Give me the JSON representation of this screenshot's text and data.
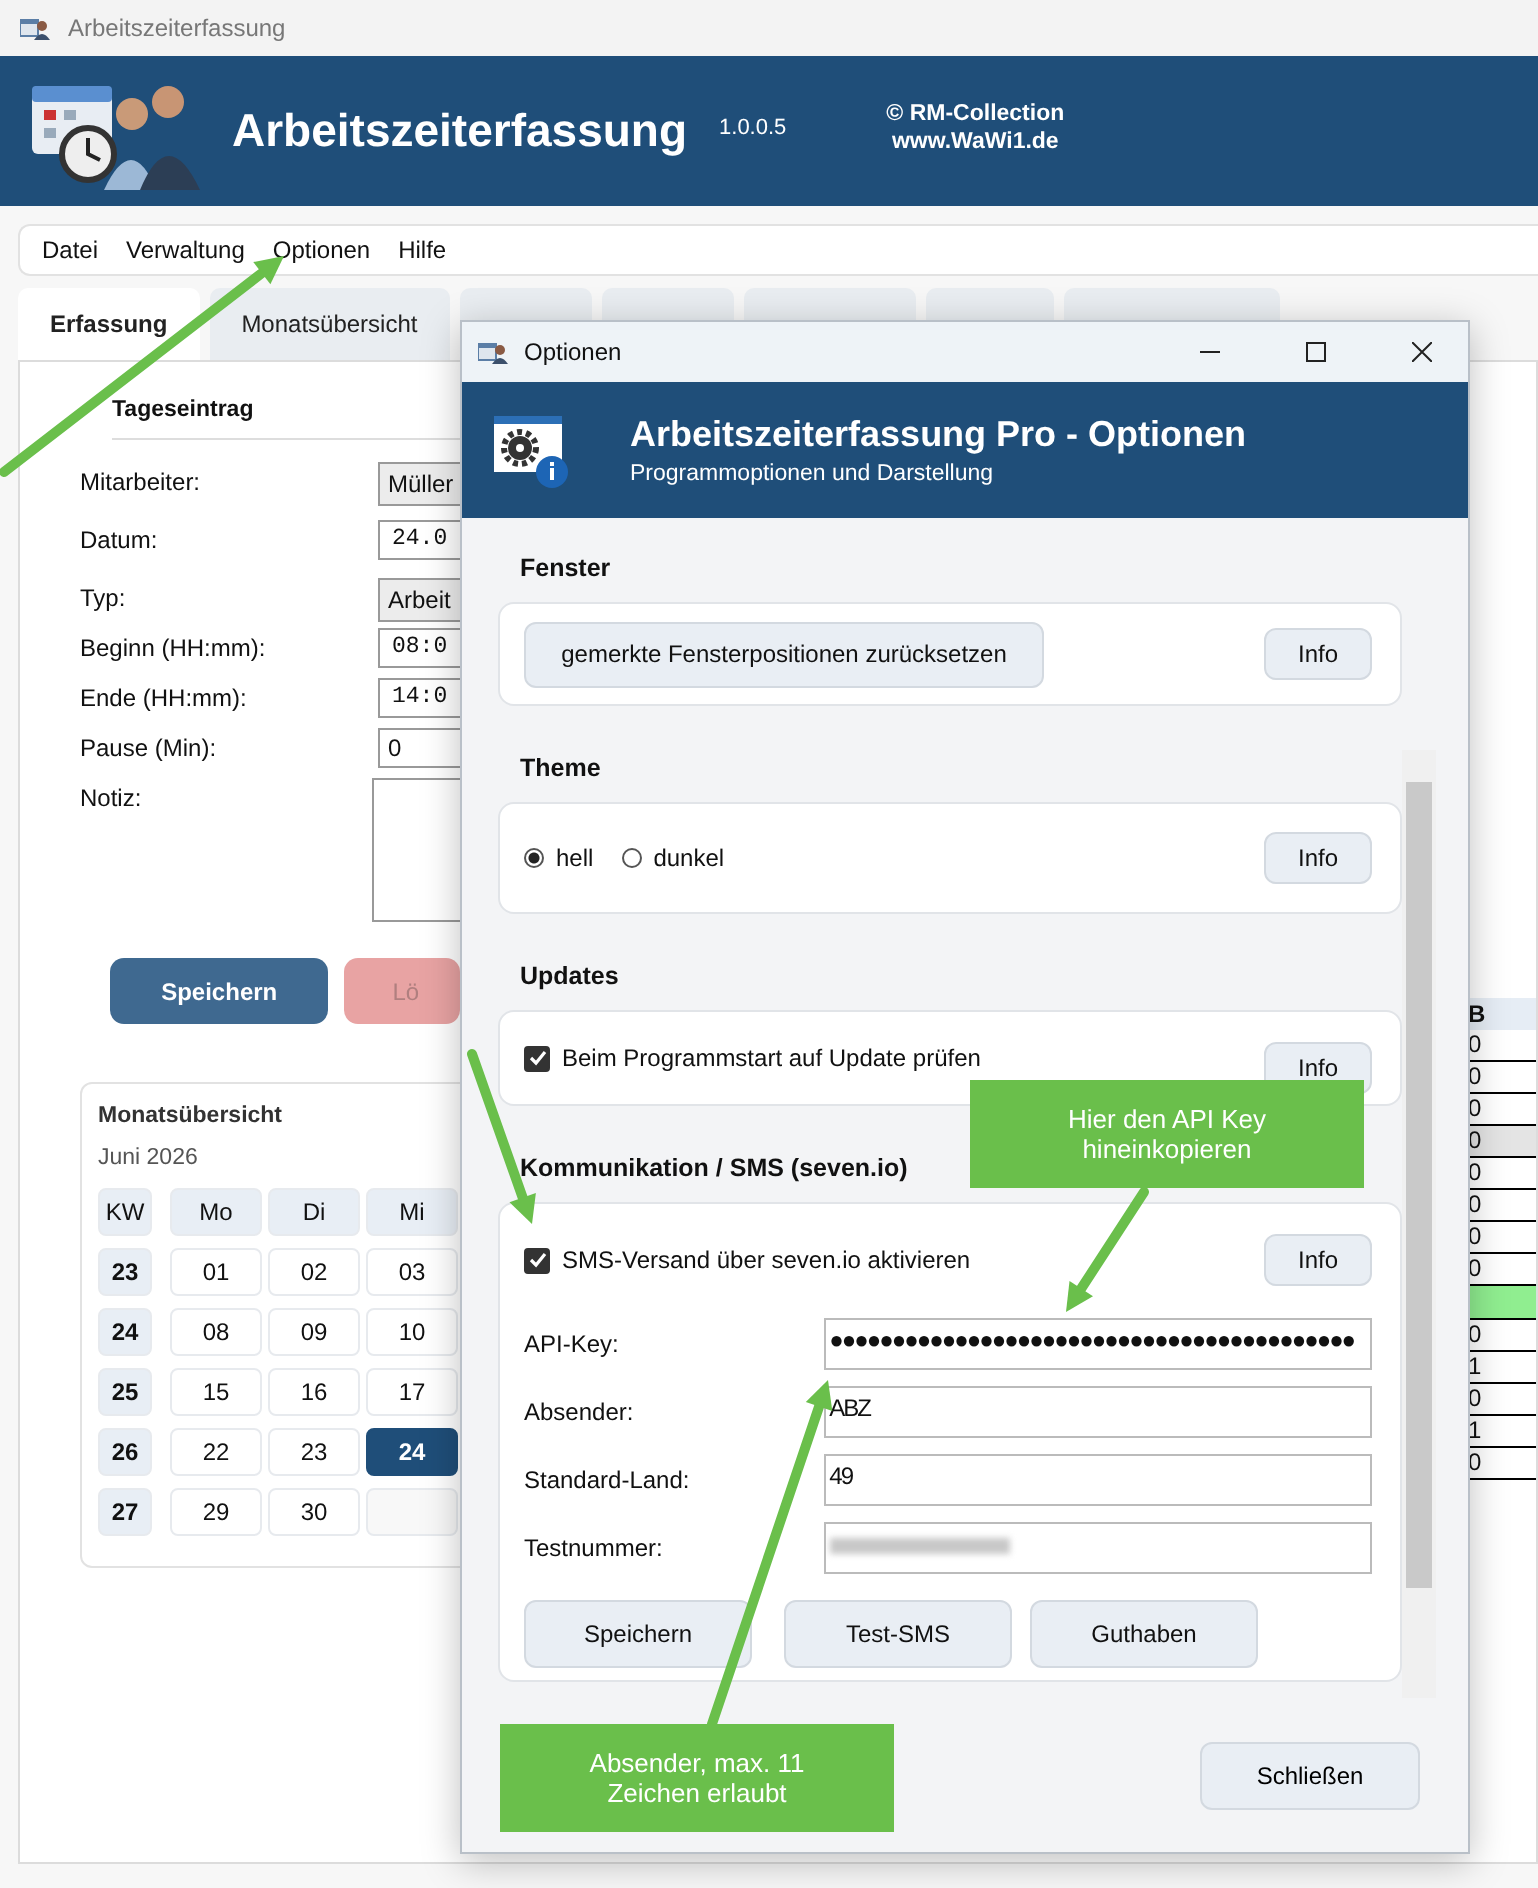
{
  "window": {
    "title": "Arbeitszeiterfassung"
  },
  "header": {
    "title": "Arbeitszeiterfassung",
    "version": "1.0.0.5",
    "copyright": "© RM-Collection",
    "website": "www.WaWi1.de"
  },
  "menu": [
    "Datei",
    "Verwaltung",
    "Optionen",
    "Hilfe"
  ],
  "tabs": [
    {
      "label": "Erfassung",
      "selected": true
    },
    {
      "label": "Monatsübersicht",
      "selected": false
    },
    {
      "selected": false
    },
    {
      "selected": false
    },
    {
      "selected": false
    },
    {
      "selected": false
    },
    {
      "selected": false
    }
  ],
  "entry": {
    "title": "Tageseintrag",
    "fields": [
      {
        "label": "Mitarbeiter:",
        "kind": "dropdown",
        "value": "Müller"
      },
      {
        "label": "Datum:",
        "kind": "date",
        "value": "24.0"
      },
      {
        "label": "Typ:",
        "kind": "dropdown",
        "value": "Arbeit"
      },
      {
        "label": "Beginn (HH:mm):",
        "kind": "time",
        "value": "08:0"
      },
      {
        "label": "Ende (HH:mm):",
        "kind": "time",
        "value": "14:0"
      },
      {
        "label": "Pause (Min):",
        "kind": "text",
        "value": "0"
      },
      {
        "label": "Notiz:",
        "kind": "textarea"
      }
    ],
    "buttons": [
      {
        "label": "Speichern",
        "kind": "primary"
      },
      {
        "label": "Lö",
        "kind": "danger"
      }
    ]
  },
  "calendar": {
    "title": "Monatsübersicht",
    "month": "Juni 2026",
    "columns": [
      "KW",
      "Mo",
      "Di",
      "Mi"
    ],
    "weeks": [
      {
        "week": "23",
        "days": [
          {
            "kind": "day",
            "day": "01",
            "selected": false
          },
          {
            "kind": "day",
            "day": "02",
            "selected": false
          },
          {
            "kind": "day",
            "day": "03",
            "selected": false
          }
        ]
      },
      {
        "week": "24",
        "days": [
          {
            "kind": "day",
            "day": "08",
            "selected": false
          },
          {
            "kind": "day",
            "day": "09",
            "selected": false
          },
          {
            "kind": "day",
            "day": "10",
            "selected": false
          }
        ]
      },
      {
        "week": "25",
        "days": [
          {
            "kind": "day",
            "day": "15",
            "selected": false
          },
          {
            "kind": "day",
            "day": "16",
            "selected": false
          },
          {
            "kind": "day",
            "day": "17",
            "selected": false
          }
        ]
      },
      {
        "week": "26",
        "days": [
          {
            "kind": "day",
            "day": "22",
            "selected": false
          },
          {
            "kind": "day",
            "day": "23",
            "selected": false
          },
          {
            "kind": "day",
            "day": "24",
            "selected": true
          }
        ]
      },
      {
        "week": "27",
        "days": [
          {
            "kind": "day",
            "day": "29",
            "selected": false
          },
          {
            "kind": "day",
            "day": "30",
            "selected": false
          },
          {
            "kind": "blank",
            "selected": false
          }
        ]
      }
    ]
  },
  "table": {
    "columns": [
      "B"
    ],
    "rows": [
      {
        "kind": "data",
        "value": "0",
        "selected": false
      },
      {
        "kind": "data",
        "value": "0",
        "selected": false
      },
      {
        "kind": "data",
        "value": "0",
        "selected": false
      },
      {
        "kind": "data",
        "value": "0",
        "selected": true
      },
      {
        "kind": "data",
        "value": "0",
        "selected": false
      },
      {
        "kind": "data",
        "value": "0",
        "selected": false
      },
      {
        "kind": "data",
        "value": "0",
        "selected": false
      },
      {
        "kind": "data",
        "value": "0",
        "selected": false
      },
      {
        "kind": "summary",
        "selected": false
      },
      {
        "kind": "data",
        "value": "0",
        "selected": false
      },
      {
        "kind": "data",
        "value": "1",
        "selected": false
      },
      {
        "kind": "data",
        "value": "0",
        "selected": false
      },
      {
        "kind": "data",
        "value": "1",
        "selected": false
      },
      {
        "kind": "data",
        "value": "0",
        "selected": false
      }
    ]
  },
  "dialog": {
    "title": "Optionen",
    "banner": {
      "title": "Arbeitszeiterfassung Pro - Optionen",
      "subtitle": "Programmoptionen und Darstellung"
    },
    "sections": [
      {
        "heading": "Fenster",
        "kind": "button",
        "button": "gemerkte Fensterpositionen zurücksetzen",
        "info": "Info"
      },
      {
        "heading": "Theme",
        "kind": "radio",
        "options": [
          {
            "label": "hell",
            "selected": true
          },
          {
            "label": "dunkel",
            "selected": false
          }
        ],
        "info": "Info"
      },
      {
        "heading": "Updates",
        "kind": "checkbox",
        "checkbox": {
          "label": "Beim Programmstart auf Update prüfen",
          "checked": true
        },
        "info": "Info"
      },
      {
        "heading": "Kommunikation / SMS (seven.io)",
        "kind": "sms",
        "checkbox": {
          "label": "SMS-Versand über seven.io aktivieren",
          "checked": true
        },
        "info": "Info",
        "fields": [
          {
            "label": "API-Key:",
            "value": "●●●●●●●●●●●●●●●●●●●●●●●●●●●●●●●●●●●●●●●●●●"
          },
          {
            "label": "Absender:",
            "value": "ABZ"
          },
          {
            "label": "Standard-Land:",
            "value": "49"
          },
          {
            "label": "Testnummer:",
            "redacted": true
          }
        ],
        "buttons": [
          "Speichern",
          "Test-SMS",
          "Guthaben"
        ]
      }
    ],
    "close_button": "Schließen"
  },
  "callouts": [
    {
      "text": "Hier den API Key hineinkopieren"
    },
    {
      "text": "Absender, max. 11 Zeichen erlaubt"
    }
  ]
}
